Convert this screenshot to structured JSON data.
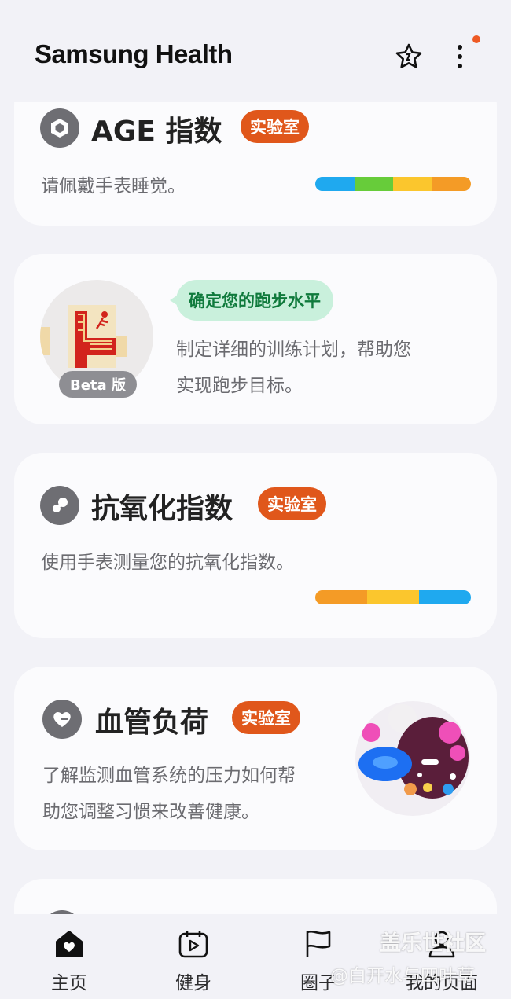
{
  "header": {
    "title": "Samsung Health",
    "icons": {
      "favorite": "star-badge-icon",
      "more": "more-vertical-icon"
    },
    "notification_color": "#ee5a24"
  },
  "cards": {
    "age": {
      "title": "AGE 指数",
      "badge": "实验室",
      "description": "请佩戴手表睡觉。",
      "icon": "hexagon-icon",
      "bar_colors": [
        "#1fa9ef",
        "#67cc3a",
        "#fbc62d",
        "#f49b26"
      ]
    },
    "running": {
      "badge": "Beta 版",
      "bubble": "确定您的跑步水平",
      "description_line1": "制定详细的训练计划，帮助您",
      "description_line2": "实现跑步目标。",
      "icon": "running-track-illustration"
    },
    "antioxidant": {
      "title": "抗氧化指数",
      "badge": "实验室",
      "description": "使用手表测量您的抗氧化指数。",
      "icon": "molecule-icon",
      "bar_colors": [
        "#f49b26",
        "#fbc62d",
        "#1fa9ef"
      ]
    },
    "vascular": {
      "title": "血管负荷",
      "badge": "实验室",
      "description_line1": "了解监测血管系统的压力如何帮",
      "description_line2": "助您调整习惯来改善健康。",
      "icon": "heart-minus-icon",
      "illustration": "blood-cell-illustration"
    }
  },
  "accent_color": "#e0571b",
  "bottom_nav": {
    "items": [
      {
        "label": "主页",
        "icon": "home-heart-icon",
        "active": true
      },
      {
        "label": "健身",
        "icon": "fitness-calendar-icon",
        "active": false
      },
      {
        "label": "圈子",
        "icon": "flag-icon",
        "active": false
      },
      {
        "label": "我的页面",
        "icon": "person-icon",
        "active": false
      }
    ]
  },
  "watermark": {
    "line1": "盖乐世社区",
    "line2": "@白开水与四叶草"
  }
}
